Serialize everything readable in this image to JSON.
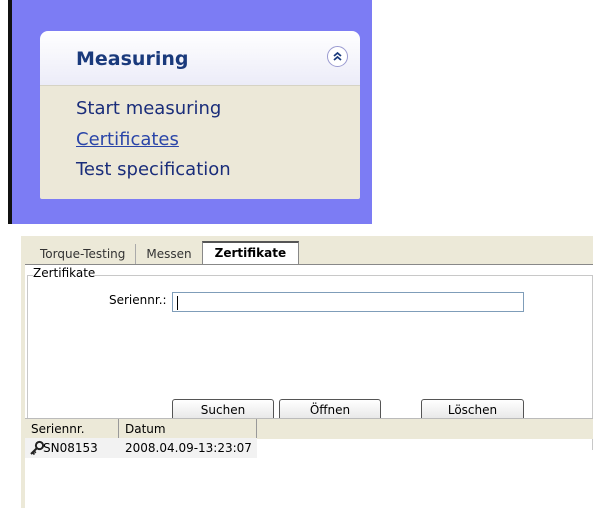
{
  "task_pane": {
    "title": "Measuring",
    "collapse_icon": "chevron-double-up-icon",
    "links": [
      "Start measuring",
      "Certificates",
      "Test specification"
    ]
  },
  "window": {
    "tabs": [
      "Torque-Testing",
      "Messen",
      "Zertifikate"
    ],
    "active_tab": "Zertifikate",
    "group_title": "Zertifikate",
    "serial_label": "Seriennr.:",
    "serial_value": "",
    "buttons": {
      "search": "Suchen",
      "open": "Öffnen",
      "delete": "Löschen"
    },
    "list": {
      "columns": [
        "Seriennr.",
        "Datum"
      ],
      "rows": [
        {
          "icon": "key-icon",
          "serial": "SN08153",
          "date": "2008.04.09-13:23:07"
        }
      ]
    }
  },
  "colors": {
    "task_pane_bg": "#7c7cf4",
    "task_group_body": "#ece8d8",
    "title_color": "#1a3a7c"
  }
}
